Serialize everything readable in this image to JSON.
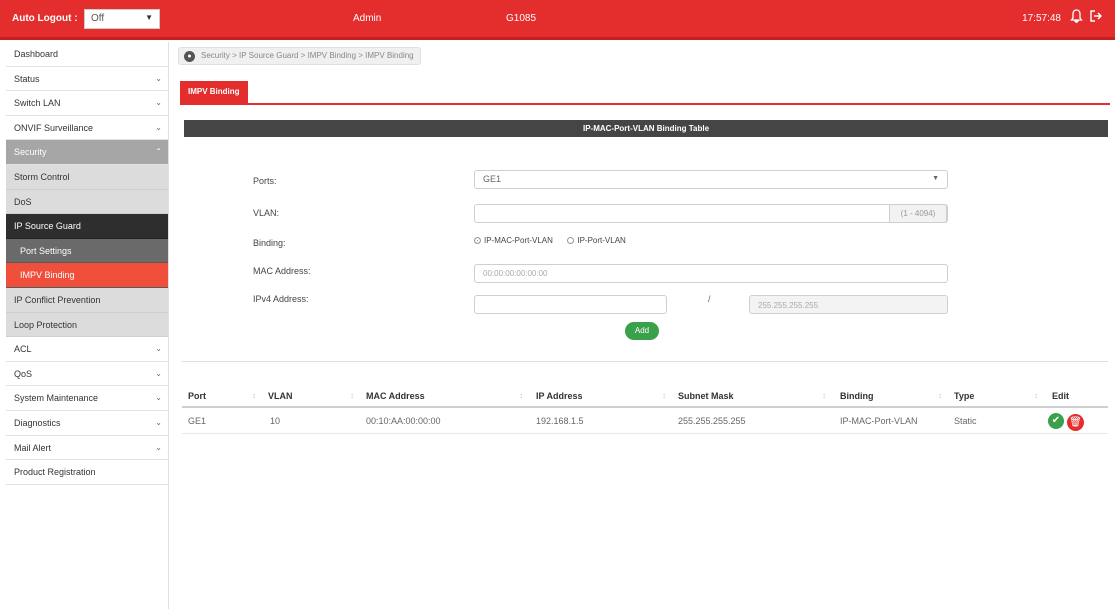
{
  "topbar": {
    "auto_logout_label": "Auto Logout :",
    "auto_logout_value": "Off",
    "user": "Admin",
    "model": "G1085",
    "time": "17:57:48"
  },
  "breadcrumb": {
    "text": "Security > IP Source Guard > IMPV Binding > IMPV Binding"
  },
  "sidebar": {
    "items": [
      {
        "label": "Dashboard"
      },
      {
        "label": "Status"
      },
      {
        "label": "Switch LAN"
      },
      {
        "label": "ONVIF Surveillance"
      },
      {
        "label": "Security"
      },
      {
        "label": "Storm Control"
      },
      {
        "label": "DoS"
      },
      {
        "label": "IP Source Guard"
      },
      {
        "label": "Port Settings"
      },
      {
        "label": "IMPV Binding"
      },
      {
        "label": "IP Conflict Prevention"
      },
      {
        "label": "Loop Protection"
      },
      {
        "label": "ACL"
      },
      {
        "label": "QoS"
      },
      {
        "label": "System Maintenance"
      },
      {
        "label": "Diagnostics"
      },
      {
        "label": "Mail Alert"
      },
      {
        "label": "Product Registration"
      }
    ]
  },
  "tabs": [
    {
      "label": "IMPV Binding"
    }
  ],
  "form": {
    "title": "IP-MAC-Port-VLAN Binding Table",
    "ports_label": "Ports:",
    "ports_value": "GE1",
    "vlan_label": "VLAN:",
    "vlan_range": "(1 - 4094)",
    "binding_label": "Binding:",
    "binding_options": [
      "IP-MAC-Port-VLAN",
      "IP-Port-VLAN"
    ],
    "mac_label": "MAC Address:",
    "mac_placeholder": "00:00:00:00:00:00",
    "ipv4_label": "IPv4 Address:",
    "slash": "/",
    "mask_placeholder": "255.255.255.255",
    "add_label": "Add"
  },
  "table": {
    "columns": [
      "Port",
      "VLAN",
      "MAC Address",
      "IP Address",
      "Subnet Mask",
      "Binding",
      "Type",
      "Edit"
    ],
    "rows": [
      {
        "port": "GE1",
        "vlan": "10",
        "mac": "00:10:AA:00:00:00",
        "ip": "192.168.1.5",
        "mask": "255.255.255.255",
        "binding": "IP-MAC-Port-VLAN",
        "type": "Static"
      }
    ]
  },
  "colors": {
    "brand": "#e42d2d",
    "active_nav": "#f04f3b",
    "success": "#3aa04a"
  }
}
